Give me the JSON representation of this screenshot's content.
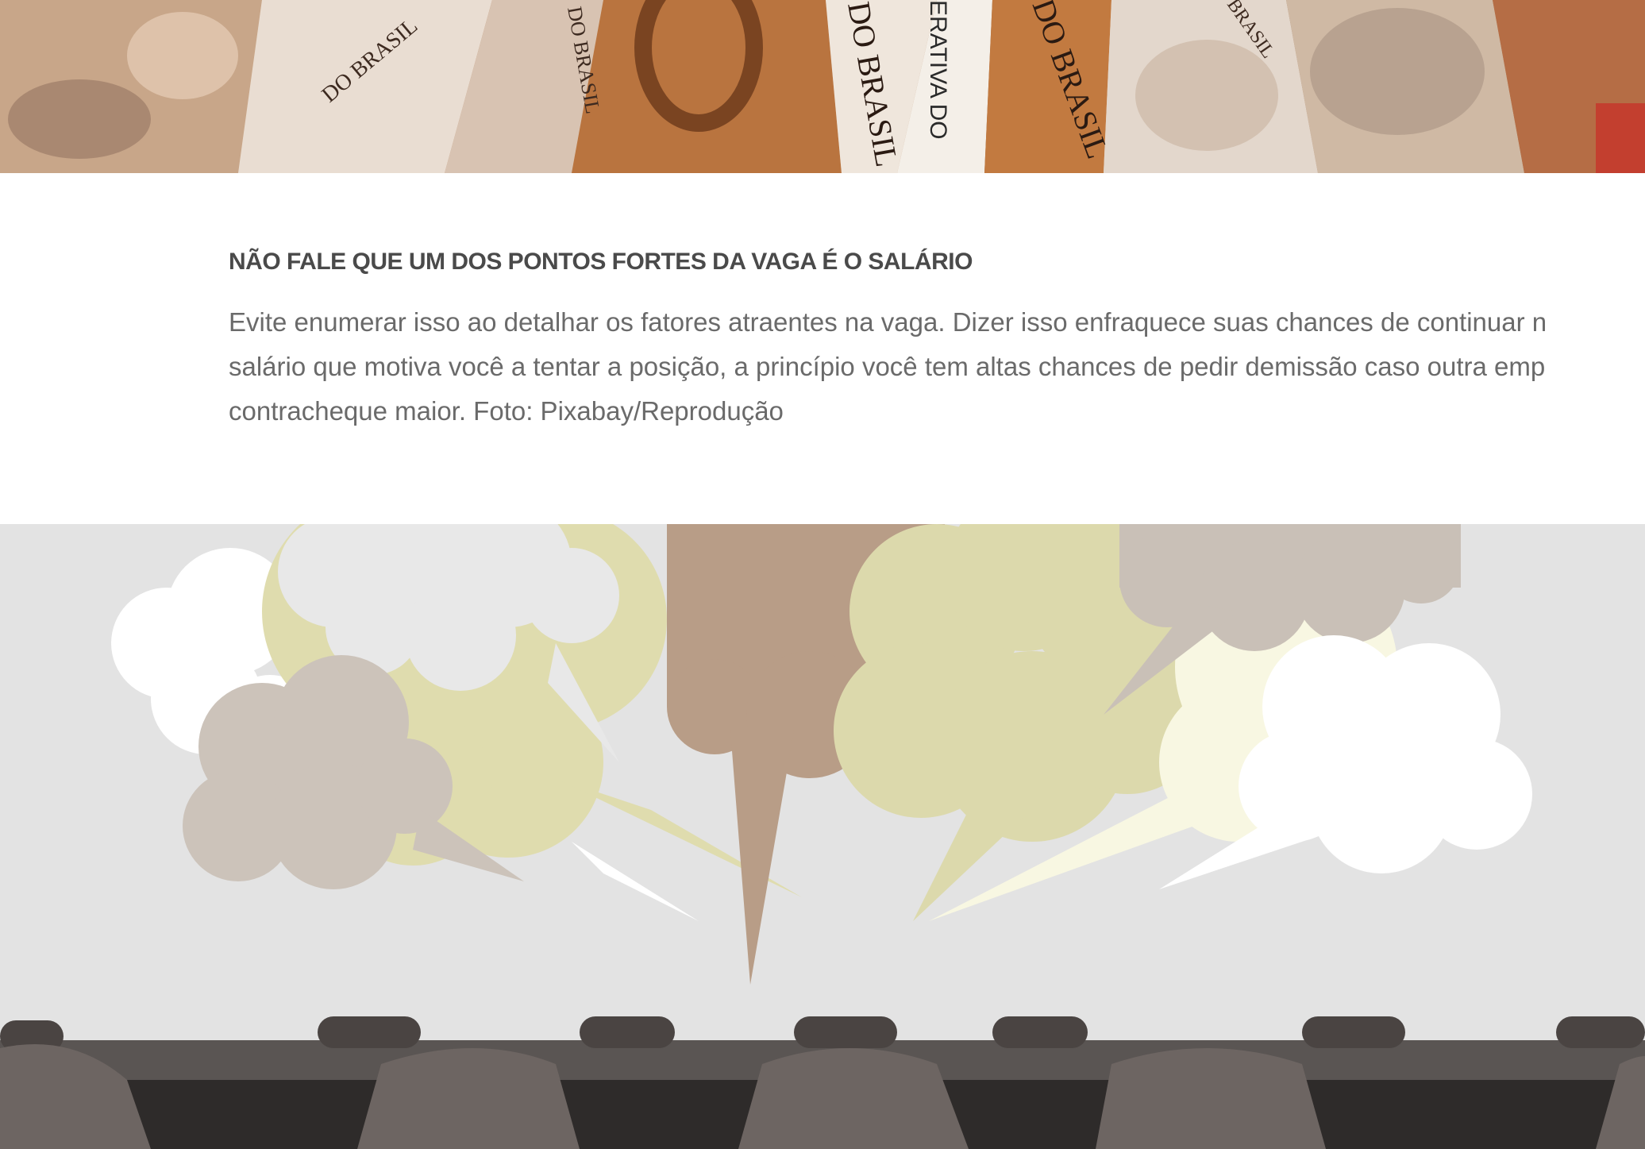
{
  "top_photo": {
    "banknote_texts": [
      "DO BRASIL",
      "DO BRASIL",
      "DO BRASIL",
      "ERATIVA DO",
      "DO BRASIL",
      "BRASIL"
    ]
  },
  "caption": {
    "title": "NÃO FALE QUE UM DOS PONTOS FORTES DA VAGA É O SALÁRIO",
    "body_lines": [
      "Evite enumerar isso ao detalhar os fatores atraentes na vaga. Dizer isso enfraquece suas chances de continuar n",
      "salário que motiva você a tentar a posição, a princípio você tem altas chances de pedir demissão caso outra emp",
      "contracheque maior.  Foto: Pixabay/Reprodução"
    ]
  },
  "bottom_photo": {}
}
